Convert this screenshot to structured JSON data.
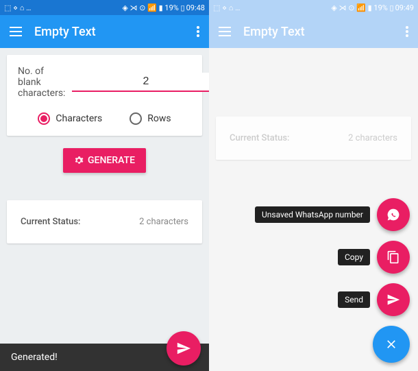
{
  "left": {
    "statusbar": {
      "left_icons": "⬚ ⋄ ⌂ …",
      "right_icons": "◈ ⋊ ⊙ 📶 ▮ 19% ▯",
      "time": "09:48"
    },
    "appbar": {
      "title": "Empty Text"
    },
    "input": {
      "label": "No. of blank characters:",
      "value": "2"
    },
    "radios": {
      "characters": "Characters",
      "rows": "Rows"
    },
    "generate": "GENERATE",
    "status": {
      "label": "Current Status:",
      "value": "2 characters"
    },
    "toast": "Generated!"
  },
  "right": {
    "statusbar": {
      "left_icons": "⬚ ⋄ ⌂ …",
      "right_icons": "◈ ⋊ ⊙ 📶 ▮ 19% ▯",
      "time": "09:49"
    },
    "appbar": {
      "title": "Empty Text"
    },
    "status": {
      "label": "Current Status:",
      "value": "2 characters"
    },
    "actions": {
      "whatsapp": "Unsaved WhatsApp number",
      "copy": "Copy",
      "send": "Send"
    }
  }
}
